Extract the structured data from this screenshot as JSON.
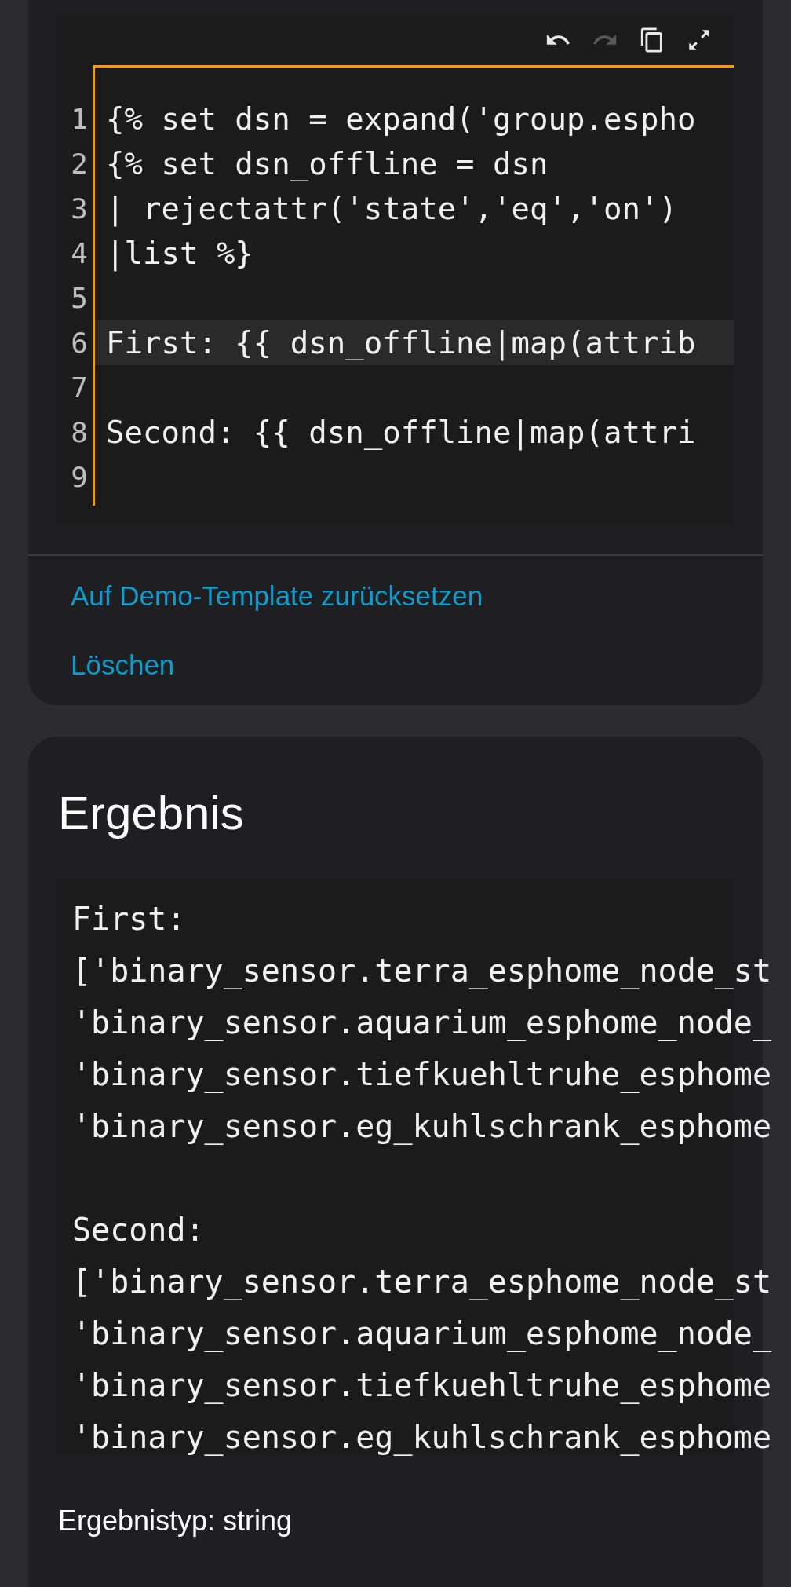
{
  "editor": {
    "focused": true,
    "toolbar": [
      {
        "kind": "undo",
        "disabled": false
      },
      {
        "kind": "redo",
        "disabled": true
      },
      {
        "kind": "copy",
        "disabled": false
      },
      {
        "kind": "fullscreen",
        "disabled": false
      }
    ],
    "lines": [
      {
        "number": "1",
        "code": "{% set dsn = expand('group.espho",
        "active": false
      },
      {
        "number": "2",
        "code": "{% set dsn_offline = dsn",
        "active": false
      },
      {
        "number": "3",
        "code": "| rejectattr('state','eq','on')",
        "active": false
      },
      {
        "number": "4",
        "code": "|list %}",
        "active": false
      },
      {
        "number": "5",
        "active": false
      },
      {
        "number": "6",
        "code": "First: {{ dsn_offline|map(attrib",
        "active": true
      },
      {
        "number": "7",
        "active": false
      },
      {
        "number": "8",
        "code": "Second: {{ dsn_offline|map(attri",
        "active": false
      },
      {
        "number": "9",
        "active": false
      }
    ]
  },
  "actions": [
    "Auf Demo-Template zurücksetzen",
    "Löschen"
  ],
  "result": {
    "title": "Ergebnis",
    "blocks": [
      {
        "lines": [
          "First:",
          "['binary_sensor.terra_esphome_node_st",
          "'binary_sensor.aquarium_esphome_node_",
          "'binary_sensor.tiefkuehltruhe_esphome",
          "'binary_sensor.eg_kuhlschrank_esphome"
        ]
      },
      {
        "lines": [
          "Second:",
          "['binary_sensor.terra_esphome_node_st",
          "'binary_sensor.aquarium_esphome_node_",
          "'binary_sensor.tiefkuehltruhe_esphome",
          "'binary_sensor.eg_kuhlschrank_esphome"
        ]
      }
    ],
    "type_label": "Ergebnistyp: string"
  }
}
